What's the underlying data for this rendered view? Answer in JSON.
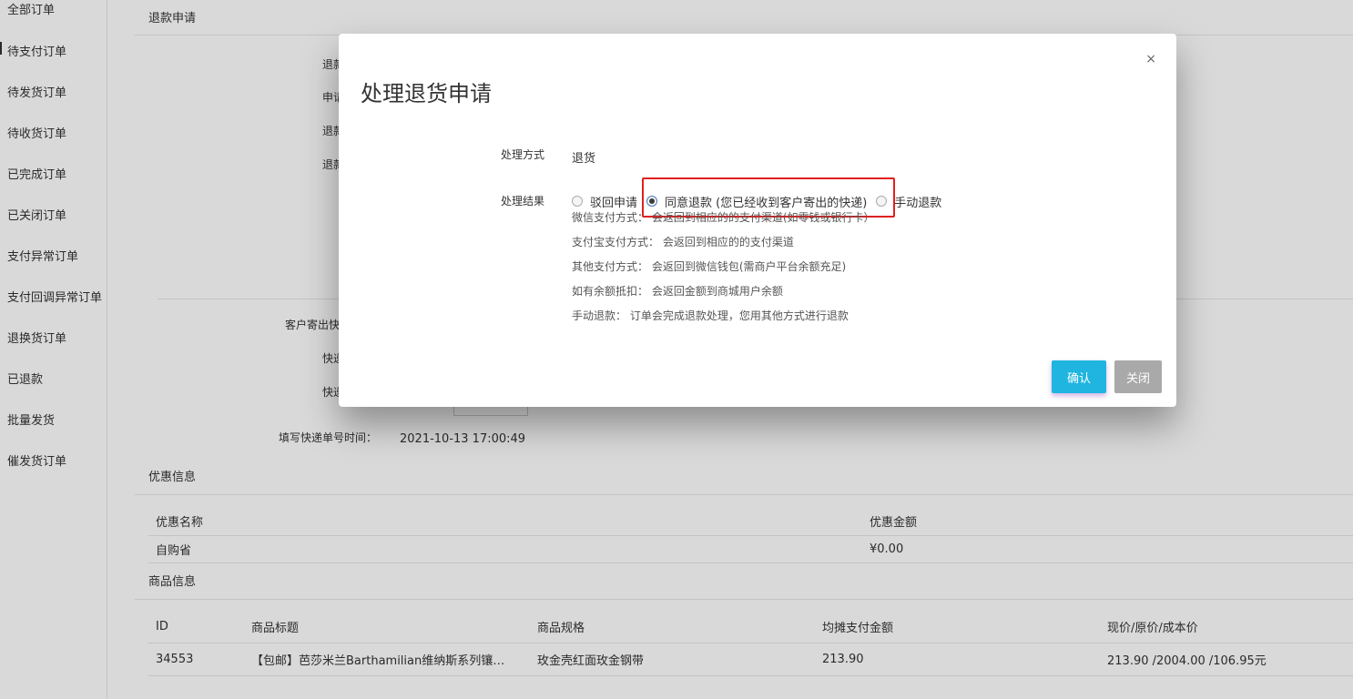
{
  "sidebar": {
    "items": [
      {
        "label": "全部订单"
      },
      {
        "label": "待支付订单"
      },
      {
        "label": "待发货订单"
      },
      {
        "label": "待收货订单"
      },
      {
        "label": "已完成订单"
      },
      {
        "label": "已关闭订单"
      },
      {
        "label": "支付异常订单"
      },
      {
        "label": "支付回调异常订单"
      },
      {
        "label": "退换货订单"
      },
      {
        "label": "已退款"
      },
      {
        "label": "批量发货"
      },
      {
        "label": "催发货订单"
      }
    ]
  },
  "refund_section": {
    "title": "退款申请",
    "labels_partial": [
      "退款",
      "申请",
      "退款",
      "退款"
    ],
    "customer_express_label": "客户寄出快",
    "express_label_1": "快递",
    "express_label_2": "快递",
    "fill_time_label": "填写快递单号时间：",
    "fill_time_value": "2021-10-13 17:00:49"
  },
  "discount_section": {
    "title": "优惠信息",
    "columns": [
      "优惠名称",
      "优惠金额"
    ],
    "rows": [
      [
        "自购省",
        "¥0.00"
      ]
    ]
  },
  "product_section": {
    "title": "商品信息",
    "columns": [
      "ID",
      "商品标题",
      "商品规格",
      "均摊支付金额",
      "现价/原价/成本价"
    ],
    "rows": [
      [
        "34553",
        "【包邮】芭莎米兰Barthamilian维纳斯系列镶…",
        "玫金壳红面玫金钢带",
        "213.90",
        "213.90 /2004.00 /106.95元"
      ]
    ]
  },
  "modal": {
    "title": "处理退货申请",
    "close_glyph": "×",
    "method_label": "处理方式",
    "method_value": "退货",
    "result_label": "处理结果",
    "options": [
      {
        "label": "驳回申请",
        "selected": false
      },
      {
        "label": "同意退款 (您已经收到客户寄出的快递)",
        "selected": true
      },
      {
        "label": "手动退款",
        "selected": false
      }
    ],
    "notes": [
      "微信支付方式： 会返回到相应的的支付渠道(如零钱或银行卡）",
      "支付宝支付方式： 会返回到相应的的支付渠道",
      "其他支付方式： 会返回到微信钱包(需商户平台余额充足)",
      "如有余额抵扣： 会返回金额到商城用户余额",
      "手动退款： 订单会完成退款处理，您用其他方式进行退款"
    ],
    "confirm_label": "确认",
    "close_label": "关闭"
  },
  "colors": {
    "confirm": "#1fb5e0",
    "close": "#a9a9a9",
    "highlight": "#e02020"
  }
}
